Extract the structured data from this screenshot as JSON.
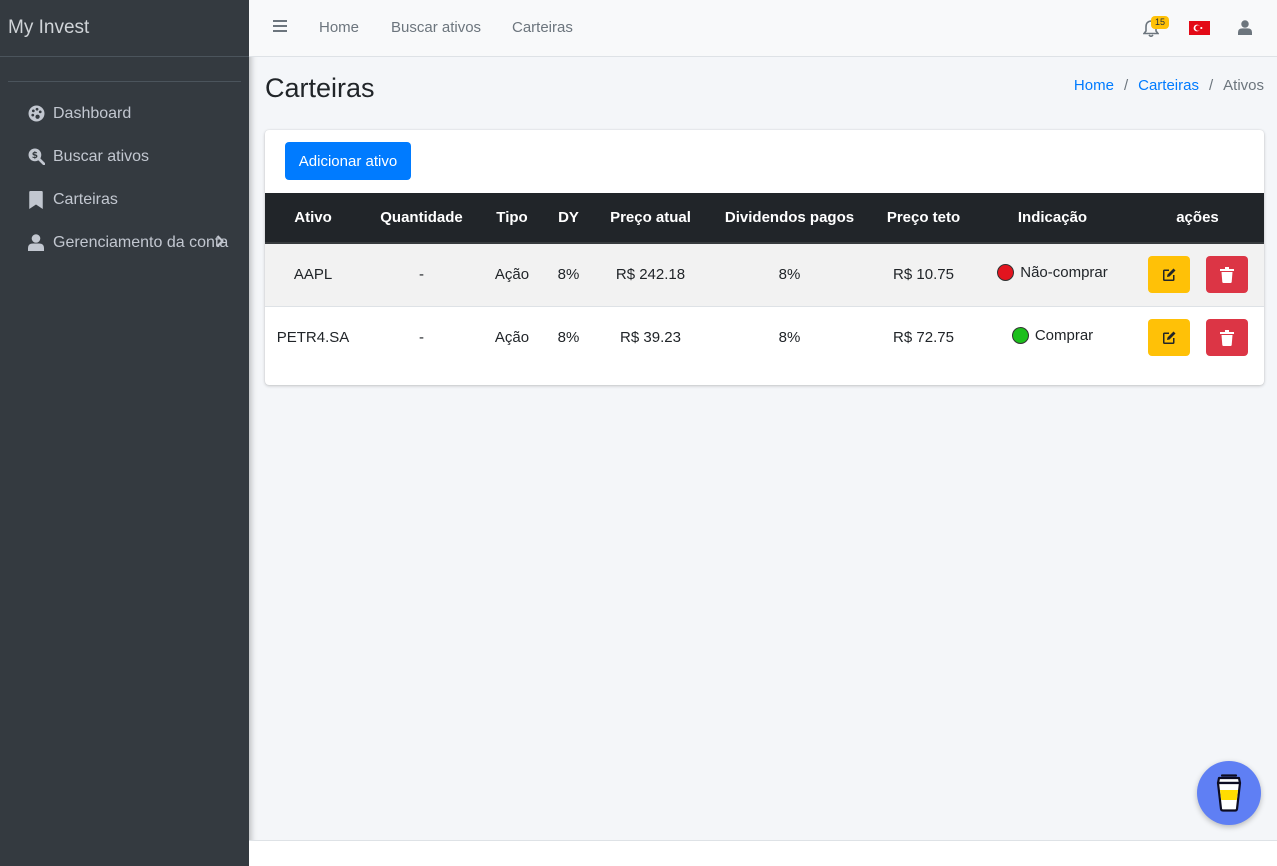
{
  "sidebar": {
    "brand": "My Invest",
    "items": [
      {
        "label": "Dashboard",
        "icon": "palette-icon"
      },
      {
        "label": "Buscar ativos",
        "icon": "search-dollar-icon"
      },
      {
        "label": "Carteiras",
        "icon": "bookmark-icon"
      },
      {
        "label": "Gerenciamento da conta",
        "icon": "user-icon"
      }
    ]
  },
  "topbar": {
    "links": [
      "Home",
      "Buscar ativos",
      "Carteiras"
    ],
    "notifications_count": "15",
    "flag": "turkey-flag-icon",
    "flag_color": "#e30a17"
  },
  "page": {
    "title": "Carteiras",
    "breadcrumb": {
      "home": "Home",
      "carteiras": "Carteiras",
      "current": "Ativos"
    }
  },
  "card": {
    "add_button": "Adicionar ativo",
    "columns": [
      "Ativo",
      "Quantidade",
      "Tipo",
      "DY",
      "Preço atual",
      "Dividendos pagos",
      "Preço teto",
      "Indicação",
      "ações"
    ],
    "rows": [
      {
        "ativo": "AAPL",
        "quantidade": "-",
        "tipo": "Ação",
        "dy": "8%",
        "preco_atual": "R$ 242.18",
        "dividendos": "8%",
        "preco_teto": "R$ 10.75",
        "indicacao": "Não-comprar",
        "indicacao_color": "#e3141f"
      },
      {
        "ativo": "PETR4.SA",
        "quantidade": "-",
        "tipo": "Ação",
        "dy": "8%",
        "preco_atual": "R$ 39.23",
        "dividendos": "8%",
        "preco_teto": "R$ 72.75",
        "indicacao": "Comprar",
        "indicacao_color": "#1cbf1c"
      }
    ]
  },
  "colors": {
    "sidebar_bg": "#343a40",
    "primary": "#007bff",
    "warning": "#ffc107",
    "danger": "#dc3545",
    "fab": "#5f7ff4"
  }
}
